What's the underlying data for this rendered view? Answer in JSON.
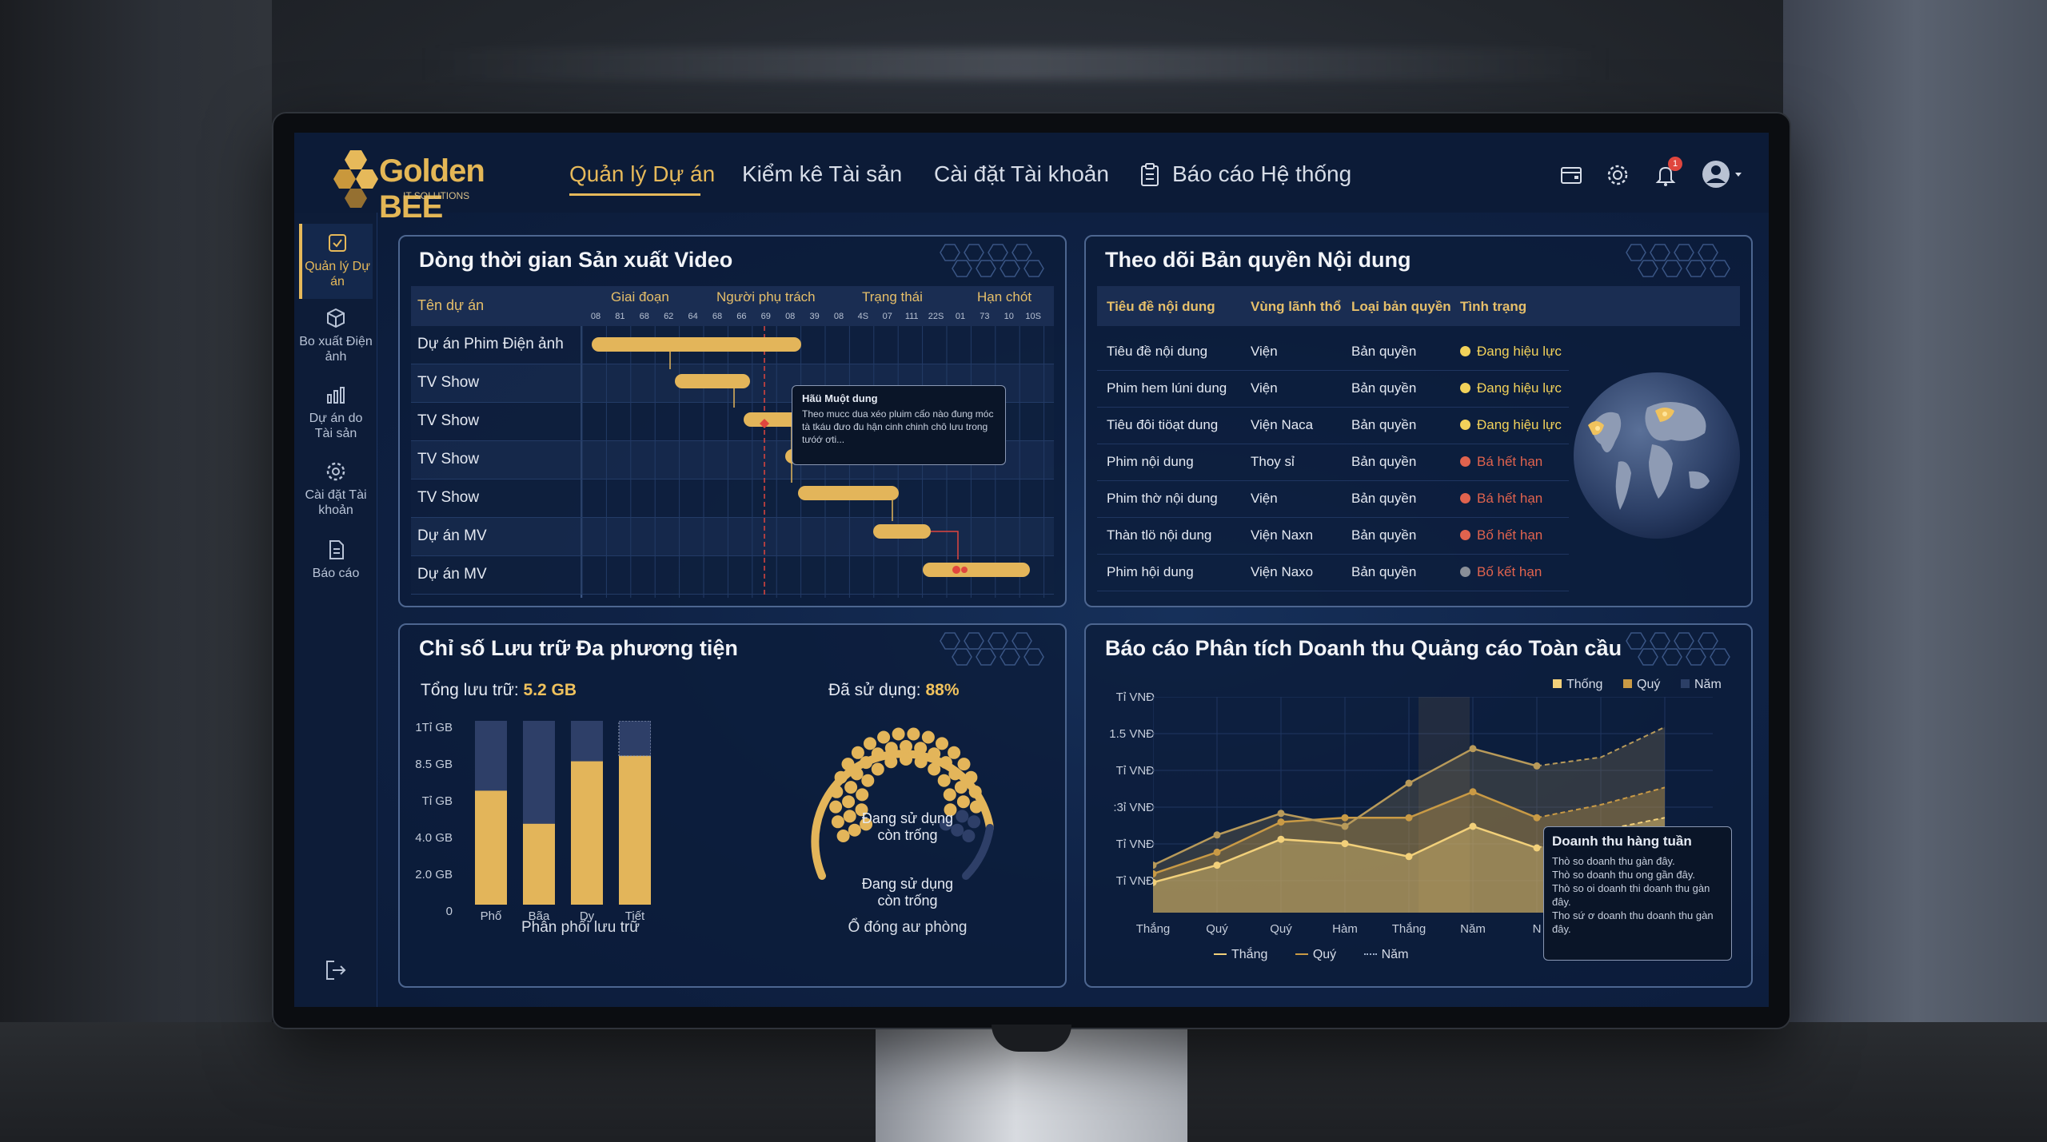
{
  "app": {
    "logo_text": "Golden BEE",
    "logo_sub": "IT SOLUTIONS"
  },
  "nav": {
    "items": [
      {
        "label": "Quản lý Dự án",
        "active": true
      },
      {
        "label": "Kiểm kê Tài sản",
        "active": false
      },
      {
        "label": "Cài đặt Tài khoản",
        "active": false
      },
      {
        "label": "Báo cáo Hệ thống",
        "active": false
      }
    ],
    "notification_count": "1"
  },
  "sidebar": {
    "items": [
      {
        "label": "Quản lý Dự án",
        "icon": "project-icon",
        "active": true
      },
      {
        "label": "Bo xuất Điện ảnh",
        "icon": "cube-icon",
        "active": false
      },
      {
        "label": "Dự án do Tài sản",
        "icon": "chart-icon",
        "active": false
      },
      {
        "label": "Cài đặt Tài khoản",
        "icon": "gear-icon",
        "active": false
      },
      {
        "label": "Báo cáo",
        "icon": "document-icon",
        "active": false
      }
    ]
  },
  "gantt": {
    "title": "Dòng thời gian Sản xuất Video",
    "col_project": "Tên dự án",
    "headers": [
      "Giai đoạn",
      "Người phụ trách",
      "Trạng thái",
      "Hạn chót"
    ],
    "ticks": [
      "08",
      "81",
      "68",
      "62",
      "64",
      "68",
      "66",
      "69",
      "08",
      "39",
      "08",
      "4S",
      "07",
      "111",
      "22S",
      "01",
      "73",
      "10",
      "10S"
    ],
    "rows": [
      "Dự án Phim Điện ảnh",
      "TV Show",
      "TV Show",
      "TV Show",
      "TV Show",
      "Dự án MV",
      "Dự án MV"
    ],
    "tooltip": {
      "title": "Hãü Muột dung",
      "body": "Theo mucc dua xéo pluim cấo nào đung móc tà tkáu đưo đu hận cinh chinh chô lưu trong tưóớ ơti..."
    }
  },
  "copyright": {
    "title": "Theo dõi Bản quyền Nội dung",
    "headers": [
      "Tiêu đề nội dung",
      "Vùng lãnh thổ",
      "Loại bản quyền",
      "Tình trạng"
    ],
    "rows": [
      {
        "title": "Tiêu đề nội dung",
        "region": "Viện",
        "type": "Bản quyền",
        "status": "Đang hiệu lực",
        "color": "#f2d25a"
      },
      {
        "title": "Phim hem lúni dung",
        "region": "Viện",
        "type": "Bản quyền",
        "status": "Đang hiệu lực",
        "color": "#f2d25a"
      },
      {
        "title": "Tiêu đôi tiöạt dung",
        "region": "Viện Naca",
        "type": "Bản quyền",
        "status": "Đang hiệu lực",
        "color": "#f2d25a"
      },
      {
        "title": "Phim nội dung",
        "region": "Thoy sỉ",
        "type": "Bản quyền",
        "status": "Bá hết hạn",
        "color": "#e0634e"
      },
      {
        "title": "Phim thờ nội dung",
        "region": "Viện",
        "type": "Bản quyền",
        "status": "Bá hết hạn",
        "color": "#e0634e"
      },
      {
        "title": "Thàn tlö nội dung",
        "region": "Viện Naxn",
        "type": "Bản quyền",
        "status": "Bố hết hạn",
        "color": "#e0634e"
      },
      {
        "title": "Phim hội dung",
        "region": "Viện Naxo",
        "type": "Bản quyền",
        "status": "Bố kết hạn",
        "color": "#8a8f98"
      }
    ]
  },
  "storage": {
    "title": "Chỉ số Lưu trữ Đa phương tiện",
    "total_label": "Tổng lưu trữ:",
    "total_value": "5.2 GB",
    "used_label": "Đã sử dụng:",
    "used_value": "88%",
    "gauge_used": "Đang sử dụng",
    "gauge_free": "còn trống",
    "gauge_used2": "Đang sử dụng",
    "gauge_free2": "còn trống",
    "bar_caption": "Phân phối lưu trữ",
    "gauge_caption": "Ổ đóng aư phòng",
    "y_ticks": [
      "1Tỉ GB",
      "8.5 GB",
      "Tỉ GB",
      "4.0 GB",
      "2.0 GB",
      "0"
    ],
    "colors": {
      "gold": "#e3b55a",
      "track": "#2e3f68"
    }
  },
  "revenue": {
    "title": "Báo cáo Phân tích Doanh thu Quảng cáo Toàn cầu",
    "legend_top": [
      "Thống",
      "Quý",
      "Năm"
    ],
    "legend_bottom": [
      "Thắng",
      "Quý",
      "Năm"
    ],
    "y_ticks": [
      "Tỉ VNĐ",
      "1.5 VNĐ",
      "Tỉ VNĐ",
      ":3ỉ VNĐ",
      "Tỉ VNĐ",
      "Tỉ VNĐ"
    ],
    "x_ticks": [
      "Thắng",
      "Quý",
      "Quý",
      "Hàm",
      "Thắng",
      "Năm",
      "N"
    ],
    "tooltip": {
      "title": "Doaınh thu hàng tuần",
      "lines": [
        "Thò so doanh thu gàn đây.",
        "Thò so doanh thu ong gần đây.",
        "Thò so oi doanh thi doanh thu gàn đây.",
        "Tho sứ ơ doanh thu doanh thu gàn đây."
      ]
    }
  },
  "chart_data": [
    {
      "type": "bar",
      "categories": [
        "Phố",
        "Bãa",
        "Dy",
        "Tiết"
      ],
      "values": [
        6.2,
        4.4,
        7.8,
        8.1
      ],
      "ylim": [
        0,
        10
      ],
      "xlabel": "Phân phối lưu trữ"
    },
    {
      "type": "line",
      "categories": [
        "Thắng",
        "Quý",
        "Quý",
        "Hàm",
        "Thắng",
        "Năm",
        "N",
        "",
        ""
      ],
      "series": [
        {
          "name": "Thắng",
          "values": [
            0.7,
            1.1,
            1.7,
            1.6,
            1.3,
            2.0,
            1.5,
            1.9,
            2.2
          ]
        },
        {
          "name": "Quý",
          "values": [
            0.9,
            1.4,
            2.1,
            2.2,
            2.2,
            2.8,
            2.2,
            2.5,
            2.9
          ]
        },
        {
          "name": "Năm",
          "values": [
            1.1,
            1.8,
            2.3,
            2.0,
            3.0,
            3.8,
            3.4,
            3.6,
            4.3
          ]
        }
      ],
      "ylim": [
        0,
        5
      ]
    }
  ]
}
